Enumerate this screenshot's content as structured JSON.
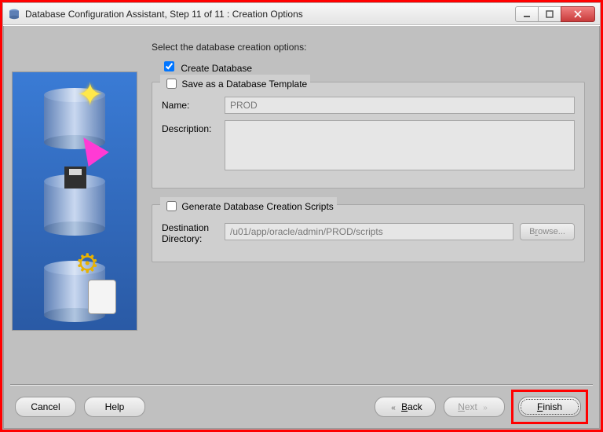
{
  "titlebar": {
    "title": "Database Configuration Assistant, Step 11 of 11 : Creation Options"
  },
  "main": {
    "instruction": "Select the database creation options:",
    "create_db": {
      "label": "Create Database",
      "checked": true
    },
    "group_template": {
      "legend": "Save as a Database Template",
      "legend_checked": false,
      "name_label": "Name:",
      "name_value": "PROD",
      "desc_label": "Description:",
      "desc_value": ""
    },
    "group_scripts": {
      "legend": "Generate Database Creation Scripts",
      "legend_checked": false,
      "dest_label": "Destination\nDirectory:",
      "dest_value": "/u01/app/oracle/admin/PROD/scripts",
      "browse_label": "Browse..."
    }
  },
  "buttons": {
    "cancel": "Cancel",
    "help": "Help",
    "back": "Back",
    "next": "Next",
    "finish": "Finish"
  }
}
